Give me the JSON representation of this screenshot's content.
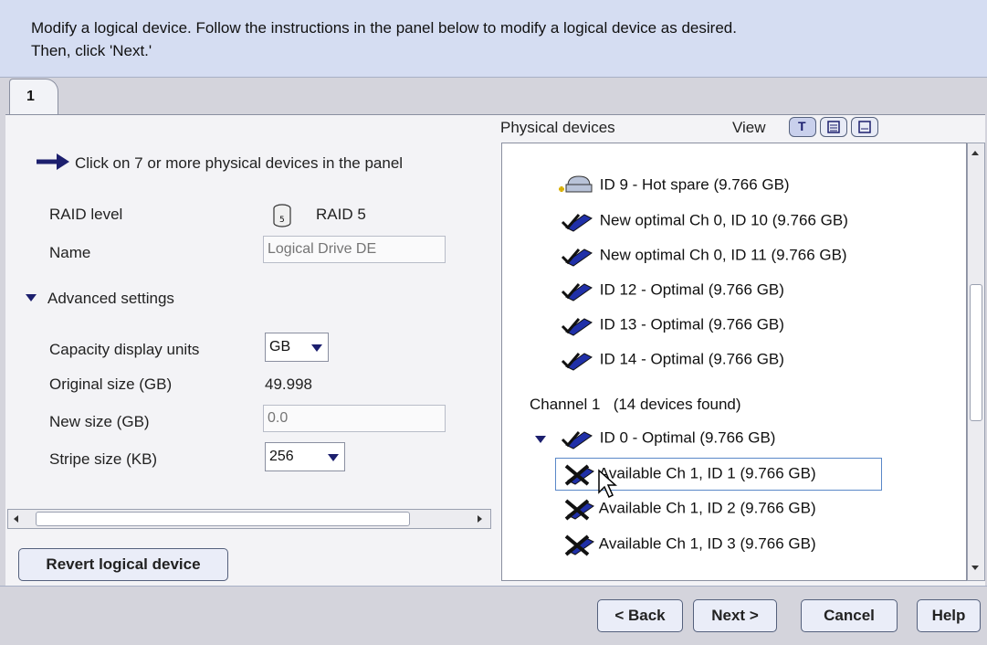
{
  "instructions": {
    "line1": "Modify a logical device.  Follow the instructions in the panel below to modify a logical device as desired.",
    "line2": "Then, click 'Next.'"
  },
  "tab": {
    "label": "1"
  },
  "left": {
    "hint": "Click on 7 or more physical devices in the panel",
    "raid_label": "RAID level",
    "raid_icon_text": "5",
    "raid_value": "RAID 5",
    "name_label": "Name",
    "name_placeholder": "Logical Drive DE",
    "advanced_label": "Advanced settings",
    "units_label": "Capacity display units",
    "units_value": "GB",
    "orig_label": "Original size (GB)",
    "orig_value": "49.998",
    "newsize_label": "New size (GB)",
    "newsize_value": "0.0",
    "stripe_label": "Stripe size (KB)",
    "stripe_value": "256",
    "revert_label": "Revert logical device"
  },
  "physical": {
    "title": "Physical devices",
    "view_label": "View",
    "view_icon_text": "T",
    "devices_top": [
      {
        "label": "ID 9 - Hot spare (9.766 GB)",
        "icon": "hot-spare-icon"
      },
      {
        "label": "New optimal  Ch 0, ID 10 (9.766 GB)",
        "icon": "optimal-drive-icon"
      },
      {
        "label": "New optimal  Ch 0, ID 11 (9.766 GB)",
        "icon": "optimal-drive-icon"
      },
      {
        "label": "ID 12 - Optimal (9.766 GB)",
        "icon": "optimal-drive-icon"
      },
      {
        "label": "ID 13 - Optimal (9.766 GB)",
        "icon": "optimal-drive-icon"
      },
      {
        "label": "ID 14 - Optimal (9.766 GB)",
        "icon": "optimal-drive-icon"
      }
    ],
    "channel_label": "Channel 1",
    "channel_count": "(14 devices found)",
    "channel_devices": [
      {
        "label": "ID 0 - Optimal (9.766 GB)",
        "icon": "optimal-drive-icon"
      },
      {
        "label": "Available  Ch 1, ID 1 (9.766 GB)",
        "icon": "available-drive-icon"
      },
      {
        "label": "Available  Ch 1, ID 2 (9.766 GB)",
        "icon": "available-drive-icon"
      },
      {
        "label": "Available  Ch 1, ID 3 (9.766 GB)",
        "icon": "available-drive-icon"
      }
    ]
  },
  "footer": {
    "back": "< Back",
    "next": "Next >",
    "cancel": "Cancel",
    "help": "Help"
  },
  "colors": {
    "accent": "#1c1f6e",
    "instruction_bg": "#d5ddf2",
    "selection_border": "#5a88c8"
  }
}
